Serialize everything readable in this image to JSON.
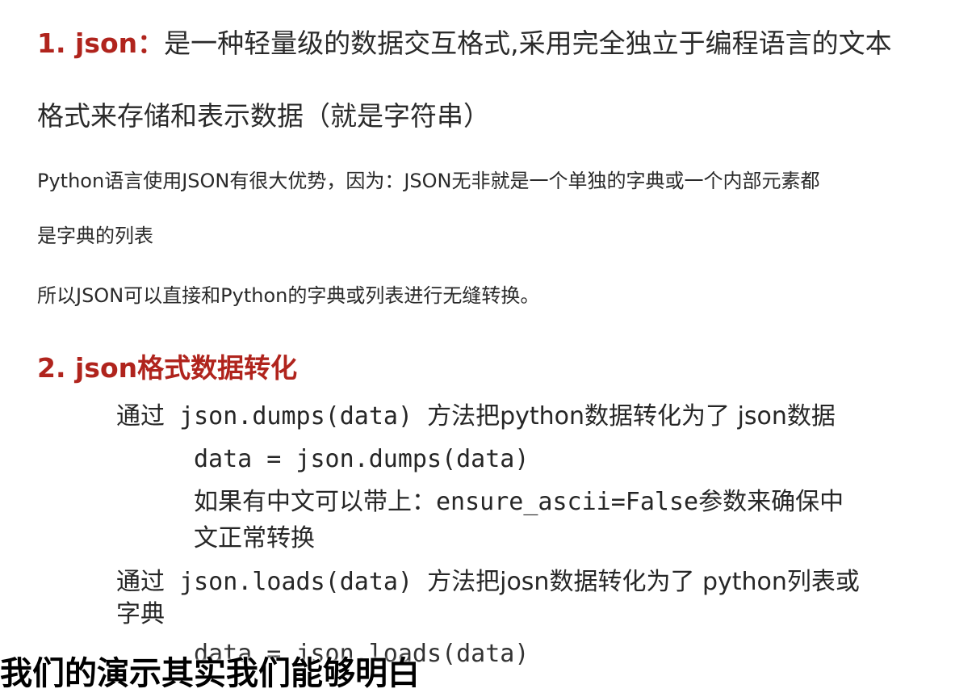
{
  "section1": {
    "heading_number": "1. json",
    "heading_sep": "：",
    "line1_rest": "是一种轻量级的数据交互格式,采用完全独立于编程语言的文本",
    "line2": "格式来存储和表示数据（就是字符串）",
    "para1_line1": "Python语言使用JSON有很大优势，因为：JSON无非就是一个单独的字典或一个内部元素都",
    "para1_line2": "是字典的列表",
    "para2": "所以JSON可以直接和Python的字典或列表进行无缝转换。"
  },
  "section2": {
    "heading": "2. json格式数据转化",
    "item1_prefix": "通过",
    "item1_code": "json.dumps(data)",
    "item1_rest": "方法把python数据转化为了 json数据",
    "item1_example": "data = json.dumps(data)",
    "item1_note_line1": "如果有中文可以带上：ensure_ascii=False参数来确保中",
    "item1_note_line2": "文正常转换",
    "item2_prefix": "通过",
    "item2_code": "json.loads(data)",
    "item2_rest": "方法把josn数据转化为了 python列表或",
    "item2_rest_line2": "字典",
    "item2_example": "data = json.loads(data)"
  },
  "subtitle": "我们的演示其实我们能够明白"
}
